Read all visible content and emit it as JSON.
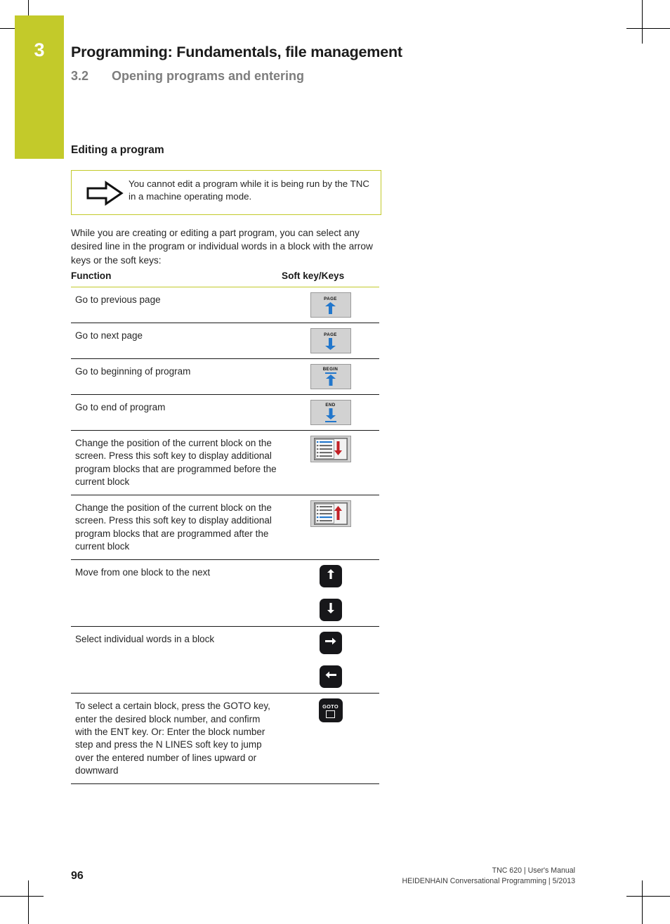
{
  "chapter": {
    "number": "3"
  },
  "header": {
    "title": "Programming: Fundamentals, file management",
    "section_number": "3.2",
    "section_title": "Opening programs and entering"
  },
  "section_title": "Editing a program",
  "note": {
    "icon": "block-arrow-right-icon",
    "text": "You cannot edit a program while it is being run by the TNC in a machine operating mode."
  },
  "intro": "While you are creating or editing a part program, you can select any desired line in the program or individual words in a block with the arrow keys or the soft keys:",
  "table": {
    "columns": {
      "function": "Function",
      "softkey": "Soft key/Keys"
    },
    "rows": [
      {
        "function": "Go to previous page",
        "keys": [
          {
            "kind": "softkey",
            "label": "PAGE",
            "icon": "page-up-icon"
          }
        ]
      },
      {
        "function": "Go to next page",
        "keys": [
          {
            "kind": "softkey",
            "label": "PAGE",
            "icon": "page-down-icon"
          }
        ]
      },
      {
        "function": "Go to beginning of program",
        "keys": [
          {
            "kind": "softkey",
            "label": "BEGIN",
            "icon": "begin-of-program-icon"
          }
        ]
      },
      {
        "function": "Go to end of program",
        "keys": [
          {
            "kind": "softkey",
            "label": "END",
            "icon": "end-of-program-icon"
          }
        ]
      },
      {
        "function": "Change the position of the current block on the screen. Press this soft key to display additional program blocks that are programmed before the current block",
        "keys": [
          {
            "kind": "softkey",
            "label": "",
            "icon": "scroll-block-down-icon"
          }
        ]
      },
      {
        "function": "Change the position of the current block on the screen. Press this soft key to display additional program blocks that are programmed after the current block",
        "keys": [
          {
            "kind": "softkey",
            "label": "",
            "icon": "scroll-block-up-icon"
          }
        ]
      },
      {
        "function": "Move from one block to the next",
        "keys": [
          {
            "kind": "hwkey",
            "label": "",
            "icon": "arrow-up-key-icon"
          },
          {
            "kind": "hwkey",
            "label": "",
            "icon": "arrow-down-key-icon"
          }
        ]
      },
      {
        "function": "Select individual words in a block",
        "keys": [
          {
            "kind": "hwkey",
            "label": "",
            "icon": "arrow-right-key-icon"
          },
          {
            "kind": "hwkey",
            "label": "",
            "icon": "arrow-left-key-icon"
          }
        ]
      },
      {
        "function": "To select a certain block, press the GOTO key, enter the desired block number, and confirm with the ENT key. Or: Enter the block number step and press the N LINES soft key to jump over the entered number of lines upward or downward",
        "keys": [
          {
            "kind": "gotokey",
            "label": "GOTO",
            "icon": "goto-key-icon"
          }
        ]
      }
    ]
  },
  "footer": {
    "page_number": "96",
    "line1": "TNC 620 | User's Manual",
    "line2": "HEIDENHAIN Conversational Programming | 5/2013"
  },
  "colors": {
    "accent_green": "#c3ca2a",
    "softkey_face": "#d2d2d2",
    "arrow_blue": "#2277cc",
    "arrow_red": "#c22026",
    "key_black": "#17171a"
  }
}
